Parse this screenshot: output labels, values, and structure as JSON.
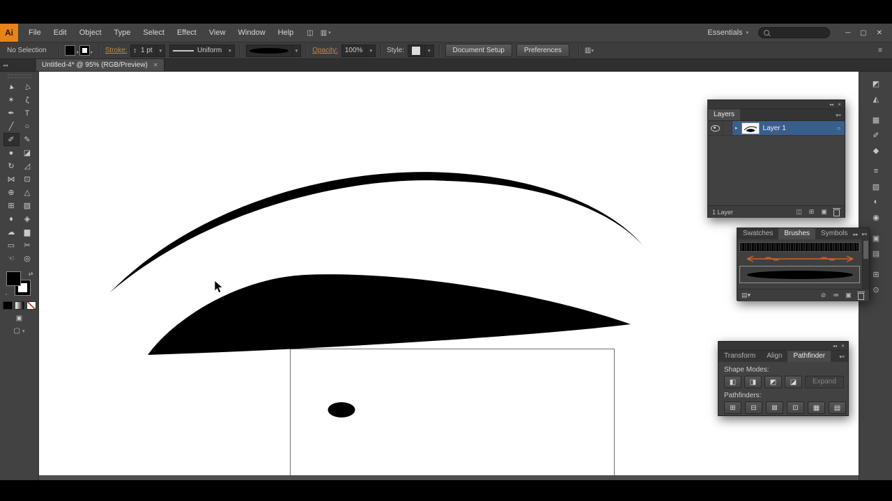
{
  "colors": {
    "accent_orange": "#E8831A",
    "selection_blue": "#3A5E8C",
    "brush_orange": "#D4622A",
    "ink_black": "#000000",
    "canvas_white": "#FFFFFF"
  },
  "icons": {
    "dropdown": "▾",
    "up": "▴",
    "collapse": "◂◂",
    "expand": "▸▸",
    "panel_menu": "▾≡",
    "close": "✕",
    "minimize": "─",
    "restore": "▢",
    "target": "○",
    "triangle_right": "▸",
    "bridge": "◫",
    "arrange": "▥",
    "menu": "≡",
    "swap": "⇄",
    "default_swatches": "▫",
    "draw_mode": "▣",
    "screen_mode": "▢"
  },
  "menubar": {
    "logo": "Ai",
    "items": [
      "File",
      "Edit",
      "Object",
      "Type",
      "Select",
      "Effect",
      "View",
      "Window",
      "Help"
    ],
    "workspace": "Essentials"
  },
  "control_bar": {
    "selection_status": "No Selection",
    "stroke_label": "Stroke:",
    "stroke_width": "1 pt",
    "profile": "Uniform",
    "opacity_label": "Opacity:",
    "opacity_value": "100%",
    "style_label": "Style:",
    "document_setup": "Document Setup",
    "preferences": "Preferences"
  },
  "document_tab": {
    "title": "Untitled-4* @ 95% (RGB/Preview)"
  },
  "toolbar": {
    "tools": [
      {
        "name": "selection-tool",
        "glyph": "►",
        "rot": true
      },
      {
        "name": "direct-selection-tool",
        "glyph": "▷",
        "rot": true
      },
      {
        "name": "magic-wand-tool",
        "glyph": "✶"
      },
      {
        "name": "lasso-tool",
        "glyph": "ζ"
      },
      {
        "name": "pen-tool",
        "glyph": "✒"
      },
      {
        "name": "type-tool",
        "glyph": "T"
      },
      {
        "name": "line-segment-tool",
        "glyph": "╱"
      },
      {
        "name": "ellipse-tool",
        "glyph": "○"
      },
      {
        "name": "paintbrush-tool",
        "glyph": "✐",
        "active": true
      },
      {
        "name": "pencil-tool",
        "glyph": "✎"
      },
      {
        "name": "blob-brush-tool",
        "glyph": "●"
      },
      {
        "name": "eraser-tool",
        "glyph": "◪"
      },
      {
        "name": "rotate-tool",
        "glyph": "↻"
      },
      {
        "name": "scale-tool",
        "glyph": "◿"
      },
      {
        "name": "width-tool",
        "glyph": "⋈"
      },
      {
        "name": "free-transform-tool",
        "glyph": "⊡"
      },
      {
        "name": "shape-builder-tool",
        "glyph": "⊕"
      },
      {
        "name": "perspective-grid-tool",
        "glyph": "△"
      },
      {
        "name": "mesh-tool",
        "glyph": "⊞"
      },
      {
        "name": "gradient-tool",
        "glyph": "▧"
      },
      {
        "name": "eyedropper-tool",
        "glyph": "♦"
      },
      {
        "name": "blend-tool",
        "glyph": "◈"
      },
      {
        "name": "symbol-sprayer-tool",
        "glyph": "☁"
      },
      {
        "name": "column-graph-tool",
        "glyph": "▆"
      },
      {
        "name": "artboard-tool",
        "glyph": "▭"
      },
      {
        "name": "slice-tool",
        "glyph": "✂"
      },
      {
        "name": "hand-tool",
        "glyph": "☜"
      },
      {
        "name": "zoom-tool",
        "glyph": "◎"
      }
    ]
  },
  "canvas": {
    "shapes": [
      "thin-curved-stroke",
      "filled-tapered-shape",
      "rectangle-outline",
      "small-black-ellipse"
    ],
    "cursor": "arrow"
  },
  "right_dock": {
    "icons": [
      {
        "name": "color-panel-icon",
        "glyph": "◩"
      },
      {
        "name": "color-guide-panel-icon",
        "glyph": "◭"
      },
      {
        "name": "swatches-panel-icon",
        "glyph": "▦",
        "gap": true
      },
      {
        "name": "brushes-panel-icon",
        "glyph": "✐"
      },
      {
        "name": "symbols-panel-icon",
        "glyph": "◆"
      },
      {
        "name": "stroke-panel-icon",
        "glyph": "≡",
        "gap": true
      },
      {
        "name": "gradient-panel-icon",
        "glyph": "▧"
      },
      {
        "name": "transparency-panel-icon",
        "glyph": "◐"
      },
      {
        "name": "appearance-panel-icon",
        "glyph": "◉"
      },
      {
        "name": "graphic-styles-panel-icon",
        "glyph": "▣",
        "gap": true
      },
      {
        "name": "layers-panel-icon",
        "glyph": "▤"
      },
      {
        "name": "artboards-panel-icon",
        "glyph": "⊞",
        "gap": true
      },
      {
        "name": "info-panel-icon",
        "glyph": "⊙"
      }
    ]
  },
  "panels": {
    "layers": {
      "title": "Layers",
      "layer_name": "Layer 1",
      "status": "1 Layer",
      "bottom_icons": [
        {
          "name": "make-clipping-mask-icon",
          "glyph": "◫"
        },
        {
          "name": "new-sublayer-icon",
          "glyph": "⊞"
        },
        {
          "name": "new-layer-icon",
          "glyph": "▣"
        },
        {
          "name": "delete-layer-icon",
          "trash": true
        }
      ]
    },
    "brushes": {
      "tabs": [
        "Swatches",
        "Brushes",
        "Symbols"
      ],
      "active_tab": "Brushes",
      "brush_items": [
        "charcoal-art-brush",
        "arrow-pattern-brush",
        "ellipse-art-brush"
      ],
      "selected_brush": "ellipse-art-brush",
      "bottom_icons": [
        {
          "name": "brush-libraries-icon",
          "glyph": "▤▾"
        },
        {
          "name": "remove-brush-stroke-icon",
          "glyph": "⊘"
        },
        {
          "name": "brush-options-icon",
          "glyph": "≔"
        },
        {
          "name": "new-brush-icon",
          "glyph": "▣"
        },
        {
          "name": "delete-brush-icon",
          "trash": true
        }
      ]
    },
    "pathfinder": {
      "tabs": [
        "Transform",
        "Align",
        "Pathfinder"
      ],
      "active_tab": "Pathfinder",
      "shape_modes_label": "Shape Modes:",
      "pathfinders_label": "Pathfinders:",
      "expand_label": "Expand",
      "shape_mode_buttons": [
        {
          "name": "unite-button",
          "glyph": "◧"
        },
        {
          "name": "minus-front-button",
          "glyph": "◨"
        },
        {
          "name": "intersect-button",
          "glyph": "◩"
        },
        {
          "name": "exclude-button",
          "glyph": "◪"
        }
      ],
      "pathfinder_buttons": [
        {
          "name": "divide-button",
          "glyph": "⊞"
        },
        {
          "name": "trim-button",
          "glyph": "⊟"
        },
        {
          "name": "merge-button",
          "glyph": "⊠"
        },
        {
          "name": "crop-button",
          "glyph": "⊡"
        },
        {
          "name": "outline-button",
          "glyph": "▦"
        },
        {
          "name": "minus-back-button",
          "glyph": "▤"
        }
      ]
    }
  }
}
